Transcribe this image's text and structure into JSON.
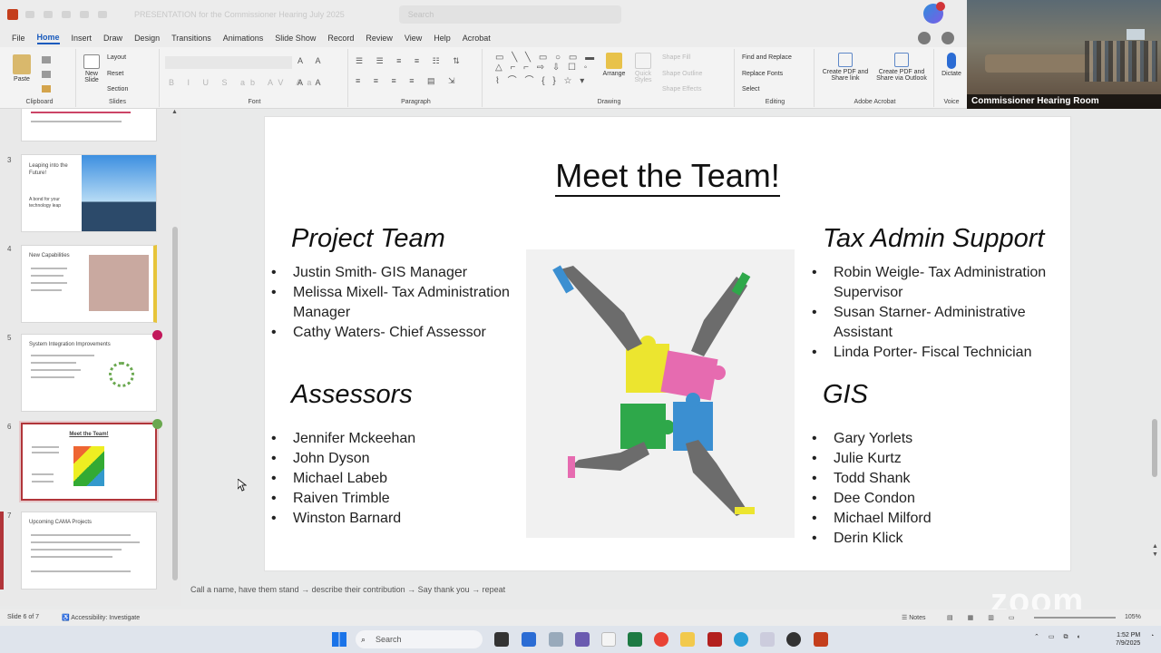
{
  "titlebar": {
    "doc_title": "PRESENTATION for the Commissioner Hearing July 2025",
    "search_placeholder": "Search"
  },
  "menu": {
    "tabs": [
      "File",
      "Home",
      "Insert",
      "Draw",
      "Design",
      "Transitions",
      "Animations",
      "Slide Show",
      "Record",
      "Review",
      "View",
      "Help",
      "Acrobat"
    ],
    "active": "Home"
  },
  "ribbon": {
    "clipboard": {
      "paste": "Paste",
      "label": "Clipboard"
    },
    "slides": {
      "new_slide": "New Slide",
      "layout": "Layout",
      "reset": "Reset",
      "section": "Section",
      "label": "Slides"
    },
    "font": {
      "label": "Font"
    },
    "paragraph": {
      "label": "Paragraph"
    },
    "drawing": {
      "arrange": "Arrange",
      "quick_styles": "Quick Styles",
      "shape_fill": "Shape Fill",
      "shape_outline": "Shape Outline",
      "shape_effects": "Shape Effects",
      "label": "Drawing"
    },
    "editing": {
      "find_replace": "Find and Replace",
      "replace_fonts": "Replace Fonts",
      "select": "Select",
      "label": "Editing"
    },
    "acrobat": {
      "create_pdf_share": "Create PDF and Share link",
      "create_pdf_outlook": "Create PDF and Share via Outlook",
      "label": "Adobe Acrobat"
    },
    "voice": {
      "dictate": "Dictate",
      "label": "Voice"
    }
  },
  "video": {
    "participant": "Commissioner Hearing Room"
  },
  "thumbnails": [
    {
      "num": "3",
      "title": "Leaping into the Future!",
      "subtitle": "A bond for your technology leap"
    },
    {
      "num": "4",
      "title": "New Capabilities"
    },
    {
      "num": "5",
      "title": "System Integration Improvements"
    },
    {
      "num": "6",
      "title": "Meet the Team!"
    },
    {
      "num": "7",
      "title": "Upcoming CAMA Projects"
    }
  ],
  "slide": {
    "title": "Meet the Team!",
    "project_team": {
      "heading": "Project Team",
      "members": [
        "Justin Smith- GIS Manager",
        "Melissa Mixell- Tax Administration Manager",
        "Cathy Waters- Chief Assessor"
      ]
    },
    "assessors": {
      "heading": "Assessors",
      "members": [
        "Jennifer Mckeehan",
        "John Dyson",
        "Michael Labeb",
        "Raiven Trimble",
        "Winston Barnard"
      ]
    },
    "tax_admin": {
      "heading": "Tax Admin Support",
      "members": [
        "Robin Weigle- Tax Administration Supervisor",
        "Susan Starner- Administrative Assistant",
        "Linda Porter- Fiscal Technician"
      ]
    },
    "gis": {
      "heading": "GIS",
      "members": [
        "Gary Yorlets",
        "Julie Kurtz",
        "Todd Shank",
        "Dee Condon",
        "Michael Milford",
        "Derin Klick"
      ]
    }
  },
  "notes_text": "Call a name, have them stand → describe their contribution → Say thank you → repeat",
  "statusbar": {
    "slide_count": "Slide 6 of 7",
    "accessibility": "Accessibility: Investigate",
    "notes": "Notes",
    "zoom": "105%"
  },
  "watermark": "zoom",
  "taskbar": {
    "search": "Search",
    "time": "1:52 PM",
    "date": "7/9/2025"
  },
  "colors": {
    "accent": "#185abd",
    "selected_thumb": "#b1353a",
    "ppt": "#c43e1c"
  }
}
